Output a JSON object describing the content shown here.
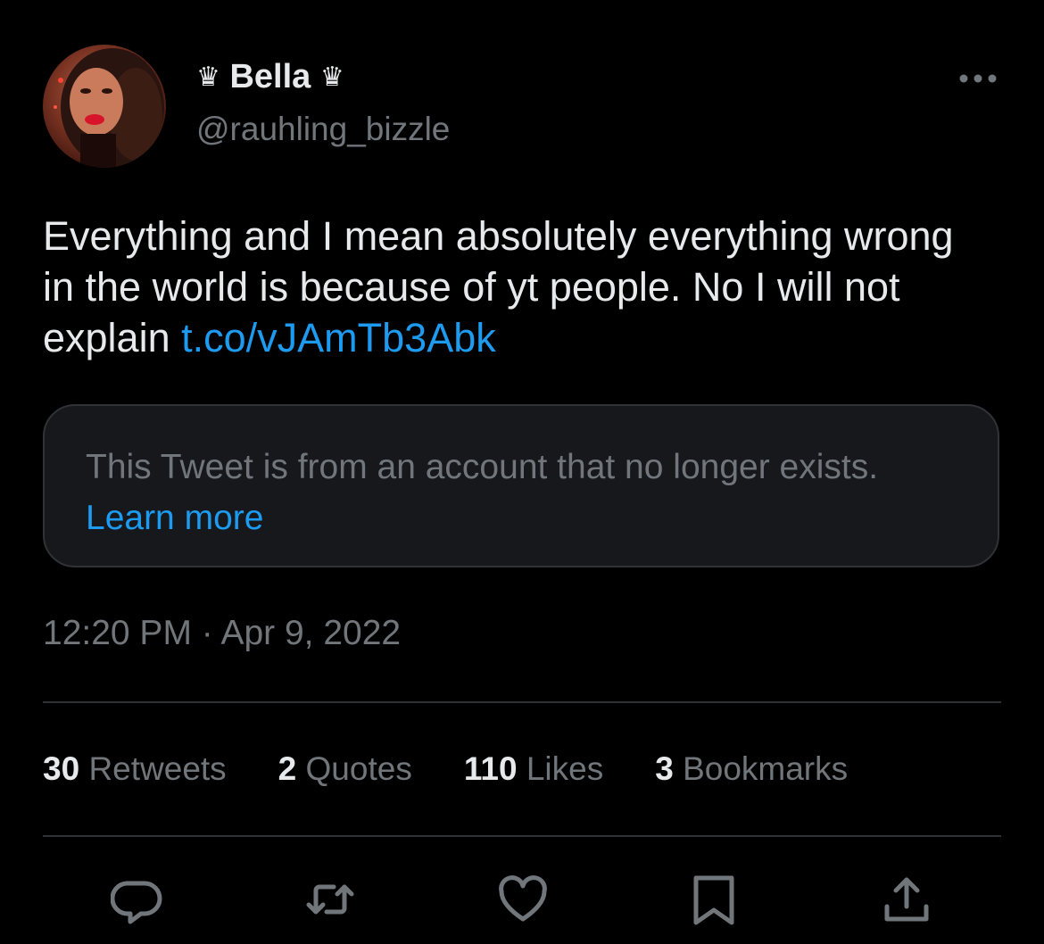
{
  "user": {
    "display_name": "Bella",
    "crown_glyph": "♛",
    "handle": "@rauhling_bizzle",
    "avatar_icon": "profile-photo"
  },
  "tweet": {
    "text": "Everything and I mean absolutely everything wrong in the world is because of yt people. No I will not explain",
    "link": "t.co/vJAmTb3Abk",
    "quoted_notice": "This Tweet is from an account that no longer exists.",
    "quoted_learn_more": "Learn more",
    "time": "12:20 PM",
    "separator": "·",
    "date": "Apr 9, 2022"
  },
  "stats": [
    {
      "count": "30",
      "label": "Retweets"
    },
    {
      "count": "2",
      "label": "Quotes"
    },
    {
      "count": "110",
      "label": "Likes"
    },
    {
      "count": "3",
      "label": "Bookmarks"
    }
  ],
  "actions": [
    {
      "icon": "reply-icon"
    },
    {
      "icon": "retweet-icon"
    },
    {
      "icon": "like-icon"
    },
    {
      "icon": "bookmark-icon"
    },
    {
      "icon": "share-icon"
    }
  ],
  "colors": {
    "background": "#000000",
    "text_primary": "#e7e9ea",
    "text_secondary": "#71767b",
    "accent": "#1d9bf0",
    "divider": "#2f3336",
    "notice_background": "#16181c"
  }
}
